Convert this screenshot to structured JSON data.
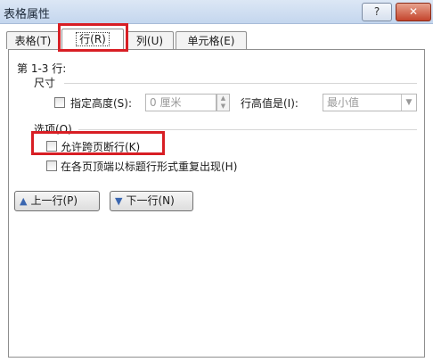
{
  "window": {
    "title": "表格属性",
    "help_label": "?",
    "close_label": "✕"
  },
  "tabs": [
    {
      "label": "表格(T)",
      "active": false
    },
    {
      "label": "行(R)",
      "active": true
    },
    {
      "label": "列(U)",
      "active": false
    },
    {
      "label": "单元格(E)",
      "active": false
    }
  ],
  "rows_panel": {
    "row_range": "第 1-3 行:",
    "size_section": "尺寸",
    "specify_height_label": "指定高度(S):",
    "height_value": "0 厘米",
    "row_height_is_label": "行高值是(I):",
    "row_height_mode": "最小值",
    "options_section": "选项(O)",
    "allow_break_label": "允许跨页断行(K)",
    "repeat_header_label": "在各页顶端以标题行形式重复出现(H)",
    "prev_row_label": "上一行(P)",
    "next_row_label": "下一行(N)"
  },
  "icons": {
    "prev": "arrow-up-icon",
    "next": "arrow-down-icon",
    "spin_up": "spin-up-icon",
    "spin_down": "spin-down-icon",
    "dropdown": "chevron-down-icon"
  },
  "colors": {
    "highlight": "#d81e24",
    "titlebar": "#c4d6ee",
    "close": "#c4452d"
  }
}
